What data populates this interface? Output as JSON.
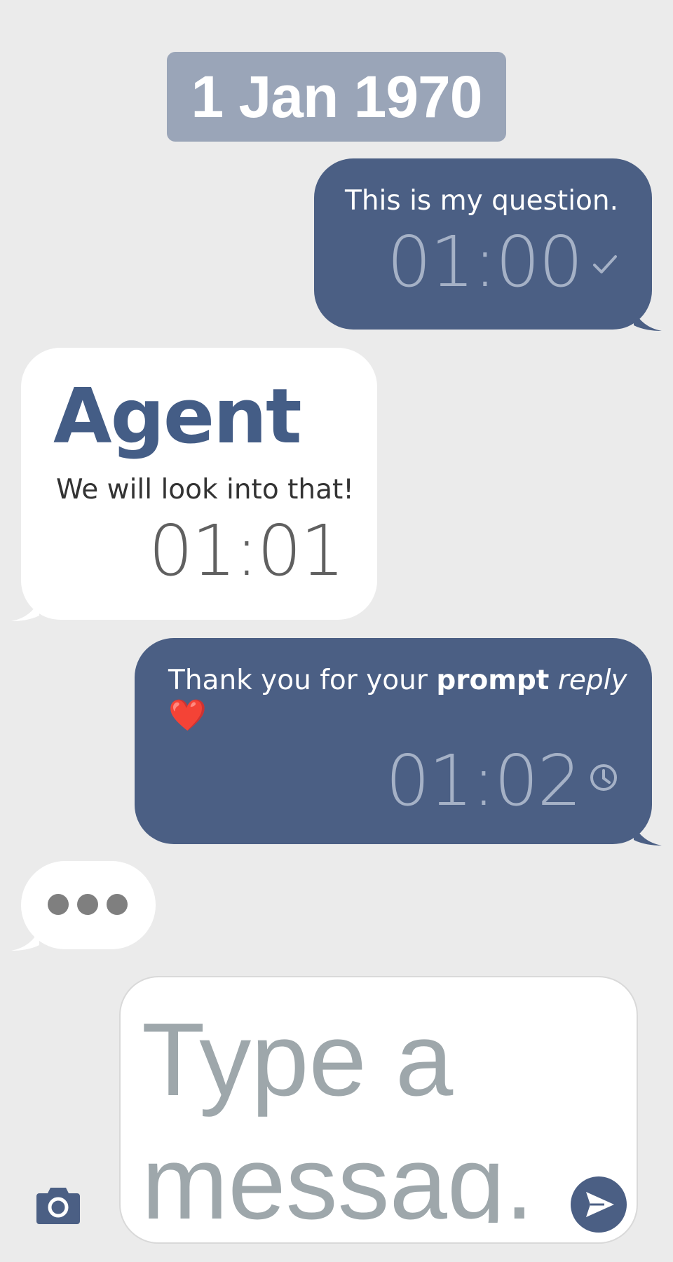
{
  "date_separator": "1 Jan 1970",
  "messages": [
    {
      "direction": "outgoing",
      "text": "This is my question.",
      "time": "01:00",
      "status": "sent-check-icon"
    },
    {
      "direction": "incoming",
      "sender": "Agent",
      "text": "We will look into that!",
      "time": "01:01"
    },
    {
      "direction": "outgoing",
      "text_plain": "Thank you for your ",
      "text_bold": "prompt",
      "text_italic": "reply",
      "emoji": "❤️",
      "time": "01:02",
      "status": "pending-clock-icon"
    }
  ],
  "typing_indicator": {
    "icon": "typing-dots-icon"
  },
  "composer": {
    "placeholder": "Type a messag...",
    "value": ""
  },
  "icons": {
    "camera": "camera-icon",
    "send": "send-icon"
  },
  "colors": {
    "accent": "#4b5f84",
    "background": "#ebebeb",
    "date_pill": "#9aa5b8",
    "placeholder": "#9ea7ab"
  }
}
